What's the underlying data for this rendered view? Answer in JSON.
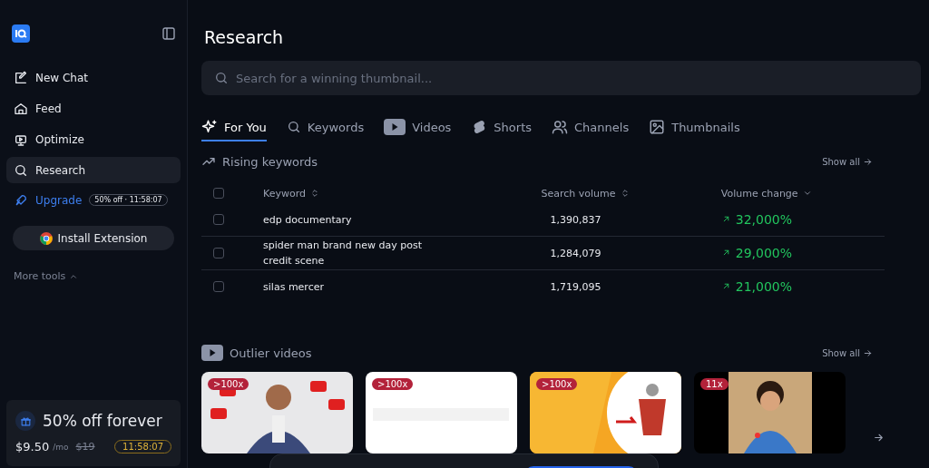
{
  "sidebar": {
    "items": [
      {
        "label": "New Chat",
        "selected": false
      },
      {
        "label": "Feed",
        "selected": false
      },
      {
        "label": "Optimize",
        "selected": false
      },
      {
        "label": "Research",
        "selected": true
      }
    ],
    "upgrade": {
      "label": "Upgrade",
      "badge": "50% off · 11:58:07"
    },
    "install_button": "Install Extension",
    "more_tools": "More tools",
    "promo": {
      "title": "50% off forever",
      "price": "$9.50",
      "period": "/mo",
      "old_price": "$19",
      "timer": "11:58:07"
    }
  },
  "page_title": "Research",
  "search": {
    "placeholder": "Search for a winning thumbnail..."
  },
  "tabs": [
    {
      "label": "For You",
      "selected": true
    },
    {
      "label": "Keywords",
      "selected": false
    },
    {
      "label": "Videos",
      "selected": false
    },
    {
      "label": "Shorts",
      "selected": false
    },
    {
      "label": "Channels",
      "selected": false
    },
    {
      "label": "Thumbnails",
      "selected": false
    }
  ],
  "rising_keywords": {
    "title": "Rising keywords",
    "show_all": "Show all",
    "select_all_checked": false,
    "columns": [
      "Keyword",
      "Search volume",
      "Volume change"
    ],
    "rows": [
      {
        "checked": false,
        "keyword": "edp documentary",
        "volume": "1,390,837",
        "change": "32,000%"
      },
      {
        "checked": false,
        "keyword": "spider man brand new day post credit scene",
        "volume": "1,284,079",
        "change": "29,000%"
      },
      {
        "checked": false,
        "keyword": "silas mercer",
        "volume": "1,719,095",
        "change": "21,000%"
      }
    ]
  },
  "outlier_videos": {
    "title": "Outlier videos",
    "show_all": "Show all",
    "videos": [
      {
        "badge": ">100x",
        "kind": "picture"
      },
      {
        "badge": ">100x",
        "kind": "picture"
      },
      {
        "badge": ">100x",
        "kind": "picture"
      },
      {
        "badge": "11x",
        "kind": "picture"
      }
    ]
  }
}
